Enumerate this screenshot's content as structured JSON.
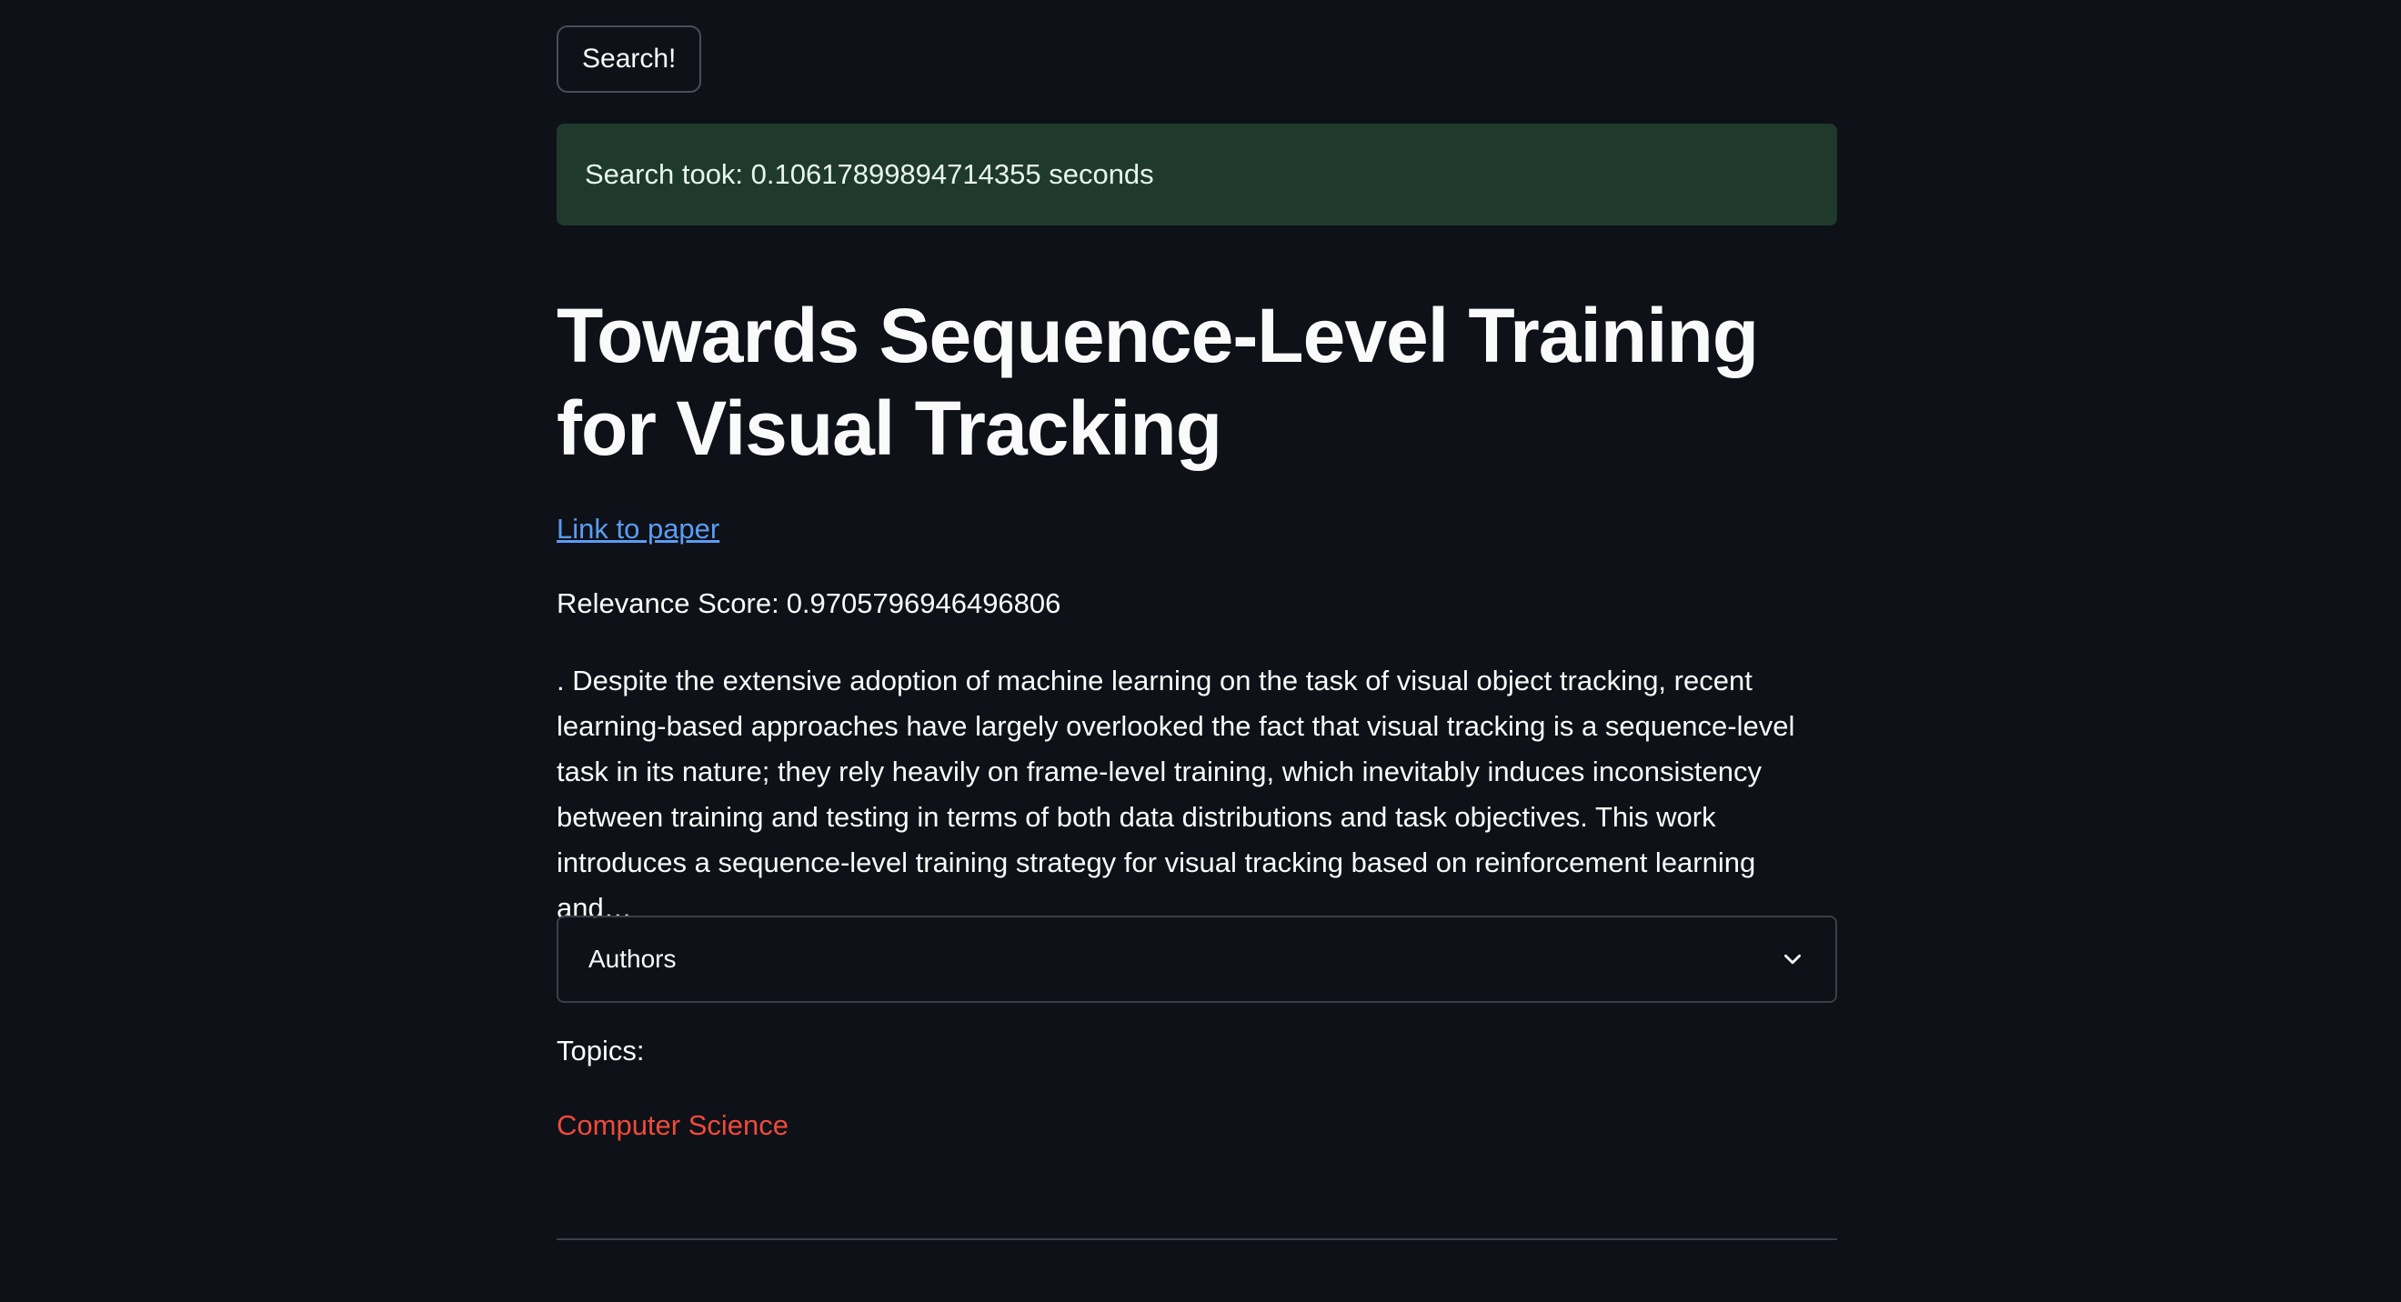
{
  "search": {
    "button_label": "Search!"
  },
  "status": {
    "message": "Search took: 0.10617899894714355 seconds"
  },
  "result": {
    "title": "Towards Sequence-Level Training for Visual Tracking",
    "link_label": "Link to paper",
    "relevance_label": "Relevance Score:",
    "relevance_value": "0.9705796946496806",
    "abstract": ". Despite the extensive adoption of machine learning on the task of visual object tracking, recent learning-based approaches have largely overlooked the fact that visual tracking is a sequence-level task in its nature; they rely heavily on frame-level training, which inevitably induces inconsistency between training and testing in terms of both data distributions and task objectives. This work introduces a sequence-level training strategy for visual tracking based on reinforcement learning and…",
    "authors_expander_label": "Authors",
    "authors_expander_icon": "chevron-down-icon",
    "topics_label": "Topics:",
    "topics": [
      "Computer Science"
    ]
  },
  "colors": {
    "background": "#0e1117",
    "success_bg": "#1f3a2c",
    "link": "#5a9cf5",
    "topic": "#f04a3a",
    "border": "#3b3f4a"
  }
}
